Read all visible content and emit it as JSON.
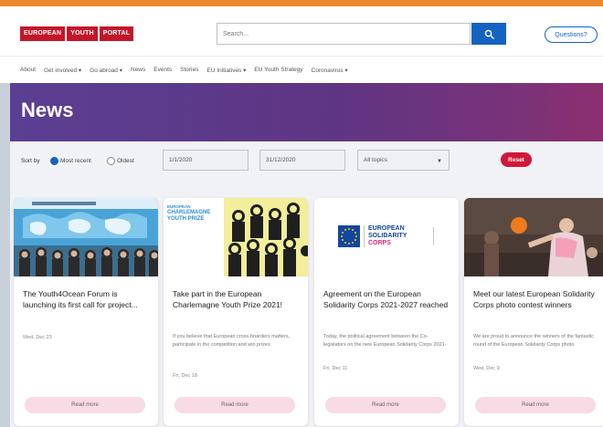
{
  "colors": {
    "top_stripe": "#ec8a2e",
    "brand_red": "#c4162a",
    "search_blue": "#1463c1",
    "hero_start": "#5b3f93",
    "hero_end": "#8c2f6f",
    "reset_red": "#d0193a",
    "read_more_pink": "#f8dbe4"
  },
  "header": {
    "logo_words": [
      "EUROPEAN",
      "YOUTH",
      "PORTAL"
    ],
    "search_placeholder": "Search...",
    "search_icon": "search-icon",
    "question_label": "Questions?"
  },
  "nav": {
    "items": [
      "About",
      "Get involved ▾",
      "Go abroad ▾",
      "News",
      "Events",
      "Stories",
      "EU Initiatives ▾",
      "EU Youth Strategy",
      "Coronavirus ▾"
    ]
  },
  "hero": {
    "title": "News"
  },
  "filters": {
    "sort_label": "Sort by",
    "sort_options": [
      "Most recent",
      "Oldest"
    ],
    "selected_sort": "Most recent",
    "date_from": "1/1/2020",
    "date_to": "31/12/2020",
    "topic_select": "All topics",
    "reset_label": "Reset"
  },
  "cards": [
    {
      "title": "The Youth4Ocean Forum is launching its first call for project...",
      "description": "",
      "date": "Wed, Dec 23",
      "button": "Read more"
    },
    {
      "title": "Take part in the European Charlemagne Youth Prize 2021!",
      "description": "If you believe that European cross-boarders matters, participate in the competition and win prizes",
      "date": "Fri, Dec 18",
      "button": "Read more",
      "image_text": [
        "EUROPEAN",
        "CHARLEMAGNE",
        "YOUTH PRIZE"
      ]
    },
    {
      "title": "Agreement on the European Solidarity Corps 2021-2027 reached",
      "description": "Today, the political agreement between the Co-legislators on the new European Solidarity Corps 2021-",
      "date": "Fri, Dec 11",
      "button": "Read more",
      "image_text": [
        "EUROPEAN",
        "SOLIDARITY",
        "CORPS"
      ]
    },
    {
      "title": "Meet our latest European Solidarity Corps photo contest winners",
      "description": "We are proud to announce the winners of the fantastic round of the European Solidarity Corps photo",
      "date": "Wed, Dec 9",
      "button": "Read more"
    }
  ]
}
